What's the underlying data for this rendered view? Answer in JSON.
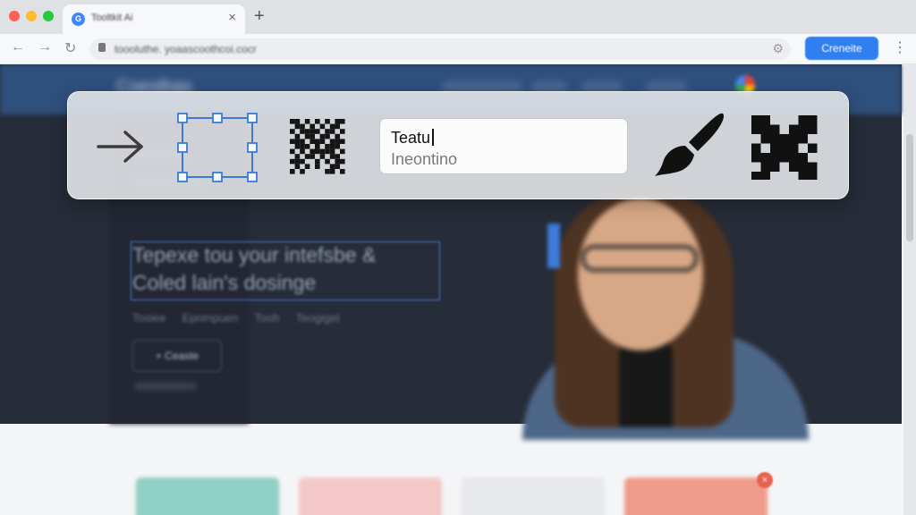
{
  "browser": {
    "tab": {
      "favicon": "G",
      "title": "Tooltkit Ai"
    },
    "new_tab": "+",
    "url": "toooluthe. yoaascoothcoi.cocr",
    "primary_button": "Creneite"
  },
  "page": {
    "brand": "Coestbas",
    "headline_line1": "Tepexe tou your intefsbe &",
    "headline_line2": "Coled lain's dosinge",
    "sub_links": [
      "Tosiee",
      "Epnmpuen",
      "Tooh",
      "Teogiget"
    ],
    "cta_button": "+ Ceaste",
    "badge": "×"
  },
  "palette": {
    "text_field": {
      "value": "Teatu",
      "placeholder": "Ineontino"
    },
    "icons": [
      "arrow-right-icon",
      "selection-box-icon",
      "pixelate-icon",
      "paintbrush-icon",
      "mosaic-icon"
    ]
  },
  "colors": {
    "accent": "#2f7ff0",
    "selection": "#3a7bd5",
    "hero_bg": "#262c38"
  }
}
